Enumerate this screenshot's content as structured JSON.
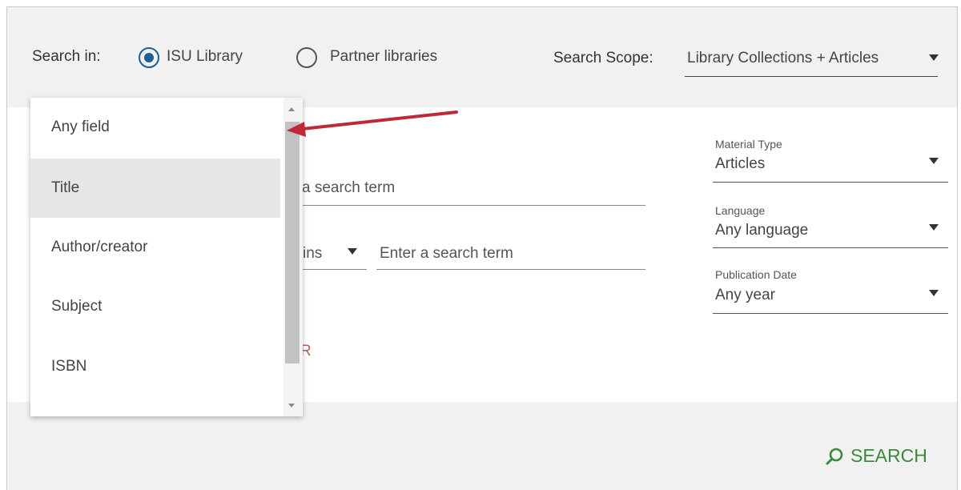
{
  "header": {
    "search_in_label": "Search in:",
    "options": [
      {
        "label": "ISU Library",
        "selected": true
      },
      {
        "label": "Partner libraries",
        "selected": false
      }
    ],
    "scope_label": "Search Scope:",
    "scope_value": "Library Collections + Articles"
  },
  "dropdown": {
    "items": [
      {
        "label": "Any field",
        "selected": false
      },
      {
        "label": "Title",
        "selected": true
      },
      {
        "label": "Author/creator",
        "selected": false
      },
      {
        "label": "Subject",
        "selected": false
      },
      {
        "label": "ISBN",
        "selected": false
      }
    ]
  },
  "query": {
    "row1_placeholder": "a search term",
    "row2_operator": "ins",
    "row2_placeholder": "Enter a search term",
    "add_row_fragment": "R"
  },
  "facets": [
    {
      "label": "Material Type",
      "value": "Articles"
    },
    {
      "label": "Language",
      "value": "Any language"
    },
    {
      "label": "Publication Date",
      "value": "Any year"
    }
  ],
  "footer": {
    "search_label": "SEARCH"
  },
  "colors": {
    "accent_radio": "#1f5f8f",
    "search_green": "#3b8a3b",
    "annotation_arrow": "#c0283a"
  },
  "icons": {
    "search": "magnifier-icon",
    "dropdown": "caret-down-icon"
  }
}
